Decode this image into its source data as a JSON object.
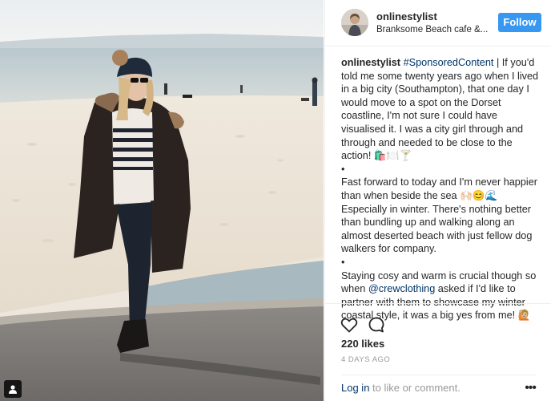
{
  "post": {
    "username": "onlinestylist",
    "location": "Branksome Beach cafe &...",
    "follow_label": "Follow",
    "caption": {
      "hashtag": "#SponsoredContent",
      "para1": " | If you'd told me some twenty years ago when I lived in a big city (Southampton), that one day I would move to a spot on the Dorset coastline, I'm not sure I could have visualised it. I was a city girl through and through and needed to be close to the action! 🛍️🍽️🍸",
      "bullet1": "•",
      "para2": "Fast forward to today and I'm never happier than when beside the sea 🙌🏻😊🌊 Especially in winter. There's nothing better than bundling up and walking along an almost deserted beach with just fellow dog walkers for company.",
      "bullet2": "•",
      "para3_start": "Staying cosy and warm is crucial though so when ",
      "mention": "@crewclothing",
      "para3_end": " asked if I'd like to partner with them to showcase my winter coastal style, it was a big yes from me! 🙋🏼"
    },
    "likes": "220 likes",
    "time": "4 DAYS AGO",
    "comment": {
      "login": "Log in",
      "rest": " to like or comment."
    },
    "more_label": "•••"
  },
  "icons": {
    "like": "heart-icon",
    "comment": "comment-bubble-icon",
    "tag": "person-tag-icon"
  },
  "colors": {
    "follow_bg": "#3897f0",
    "link": "#003569",
    "muted": "#999999"
  }
}
